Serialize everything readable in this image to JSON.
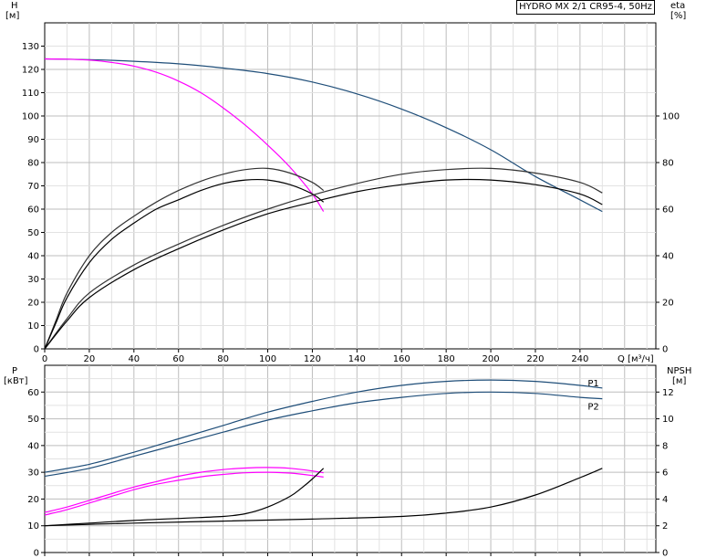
{
  "chart_data": {
    "type": "line",
    "title": "HYDRO MX 2/1 CR95-4, 50Hz",
    "xlabel": "Q [м³/ч]",
    "x_ticks": [
      "0",
      "20",
      "40",
      "60",
      "80",
      "100",
      "120",
      "140",
      "160",
      "180",
      "200",
      "220",
      "240"
    ],
    "top": {
      "ylabel_left": "H",
      "yunit_left": "[м]",
      "ylabel_right": "eta",
      "yunit_right": "[%]",
      "ylim_left": [
        0,
        140
      ],
      "ylim_right": [
        0,
        140
      ],
      "yticks_left": [
        "0",
        "10",
        "20",
        "30",
        "40",
        "50",
        "60",
        "70",
        "80",
        "90",
        "100",
        "110",
        "120",
        "130"
      ],
      "yticks_right": [
        "0",
        "20",
        "40",
        "60",
        "80",
        "100"
      ],
      "series": [
        {
          "key": "H_two",
          "color": "#1f4e79",
          "x": [
            0,
            20,
            40,
            60,
            80,
            100,
            120,
            140,
            160,
            180,
            200,
            220,
            240,
            250
          ],
          "y": [
            124.5,
            124.2,
            123.5,
            122.4,
            120.6,
            118.2,
            114.6,
            109.5,
            103.0,
            95.0,
            85.5,
            74.0,
            64.0,
            59.0
          ]
        },
        {
          "key": "H_one",
          "color": "#ff00ff",
          "x": [
            0,
            10,
            20,
            30,
            40,
            50,
            60,
            70,
            80,
            90,
            100,
            110,
            120,
            125
          ],
          "y": [
            124.5,
            124.4,
            124.0,
            123.0,
            121.4,
            118.8,
            115.0,
            110.0,
            103.5,
            96.0,
            87.5,
            78.0,
            66.5,
            59.0
          ]
        },
        {
          "key": "eta_one_a",
          "color": "#333333",
          "axis": "right",
          "x": [
            0,
            5,
            10,
            20,
            30,
            40,
            50,
            60,
            70,
            80,
            90,
            100,
            110,
            120,
            125
          ],
          "y": [
            0,
            12,
            24,
            40,
            50,
            57,
            63,
            68,
            72,
            75,
            77,
            77.5,
            75.5,
            71.5,
            68
          ]
        },
        {
          "key": "eta_one_b",
          "color": "#000000",
          "axis": "right",
          "x": [
            0,
            5,
            10,
            20,
            30,
            40,
            50,
            60,
            70,
            80,
            90,
            100,
            110,
            120,
            125
          ],
          "y": [
            0,
            11,
            22,
            37,
            47,
            54,
            60,
            64,
            68,
            71,
            72.5,
            72.5,
            70.5,
            66.5,
            63
          ]
        },
        {
          "key": "eta_two_a",
          "color": "#333333",
          "axis": "right",
          "x": [
            0,
            10,
            20,
            40,
            60,
            80,
            100,
            120,
            140,
            160,
            180,
            200,
            220,
            240,
            250
          ],
          "y": [
            0,
            13,
            24,
            36,
            45,
            53,
            60,
            66,
            71,
            75,
            77,
            77.5,
            75.5,
            71.5,
            67
          ]
        },
        {
          "key": "eta_two_b",
          "color": "#000000",
          "axis": "right",
          "x": [
            0,
            10,
            20,
            40,
            60,
            80,
            100,
            120,
            140,
            160,
            180,
            200,
            220,
            240,
            250
          ],
          "y": [
            0,
            12,
            22,
            34,
            43,
            51,
            58,
            63,
            67.5,
            70.5,
            72.5,
            72.5,
            70.5,
            66.5,
            62
          ]
        }
      ]
    },
    "bottom": {
      "ylabel_left": "P",
      "yunit_left": "[кВт]",
      "ylabel_right": "NPSH",
      "yunit_right": "[м]",
      "ylim_left": [
        0,
        70
      ],
      "ylim_right": [
        0,
        14
      ],
      "yticks_left": [
        "0",
        "10",
        "20",
        "30",
        "40",
        "50",
        "60"
      ],
      "yticks_right": [
        "0",
        "2",
        "4",
        "6",
        "8",
        "10",
        "12"
      ],
      "series": [
        {
          "key": "P1",
          "label": "P1",
          "color": "#1f4e79",
          "x": [
            0,
            20,
            40,
            60,
            80,
            100,
            120,
            140,
            160,
            180,
            200,
            220,
            240,
            250
          ],
          "y": [
            30,
            33,
            37.5,
            42.5,
            47.5,
            52.5,
            56.5,
            60,
            62.5,
            64,
            64.5,
            64,
            62.5,
            61.5
          ]
        },
        {
          "key": "P2",
          "label": "P2",
          "color": "#1f4e79",
          "x": [
            0,
            20,
            40,
            60,
            80,
            100,
            120,
            140,
            160,
            180,
            200,
            220,
            240,
            250
          ],
          "y": [
            28.5,
            31.5,
            36,
            40.5,
            45,
            49.5,
            53,
            56,
            58,
            59.5,
            60,
            59.5,
            58,
            57.5
          ]
        },
        {
          "key": "P1_one",
          "color": "#ff00ff",
          "x": [
            0,
            10,
            20,
            30,
            40,
            50,
            60,
            70,
            80,
            90,
            100,
            110,
            120,
            125
          ],
          "y": [
            15,
            17,
            19.5,
            22,
            24.5,
            26.5,
            28.5,
            30,
            31,
            31.6,
            31.8,
            31.5,
            30.5,
            29.8
          ]
        },
        {
          "key": "P2_one",
          "color": "#ff00ff",
          "x": [
            0,
            10,
            20,
            30,
            40,
            50,
            60,
            70,
            80,
            90,
            100,
            110,
            120,
            125
          ],
          "y": [
            14,
            16,
            18.5,
            21,
            23.5,
            25.5,
            27,
            28.3,
            29.2,
            29.8,
            30,
            29.7,
            28.8,
            28.2
          ]
        },
        {
          "key": "NPSH_one",
          "color": "#000000",
          "axis": "right",
          "x": [
            0,
            20,
            40,
            60,
            80,
            90,
            100,
            110,
            115,
            120,
            125
          ],
          "y": [
            2,
            2.2,
            2.4,
            2.55,
            2.7,
            2.9,
            3.4,
            4.2,
            4.8,
            5.5,
            6.3
          ]
        },
        {
          "key": "NPSH_two",
          "color": "#000000",
          "axis": "right",
          "x": [
            0,
            40,
            80,
            120,
            160,
            180,
            200,
            220,
            240,
            250
          ],
          "y": [
            2,
            2.2,
            2.35,
            2.5,
            2.7,
            2.95,
            3.4,
            4.3,
            5.6,
            6.3
          ]
        }
      ]
    }
  }
}
